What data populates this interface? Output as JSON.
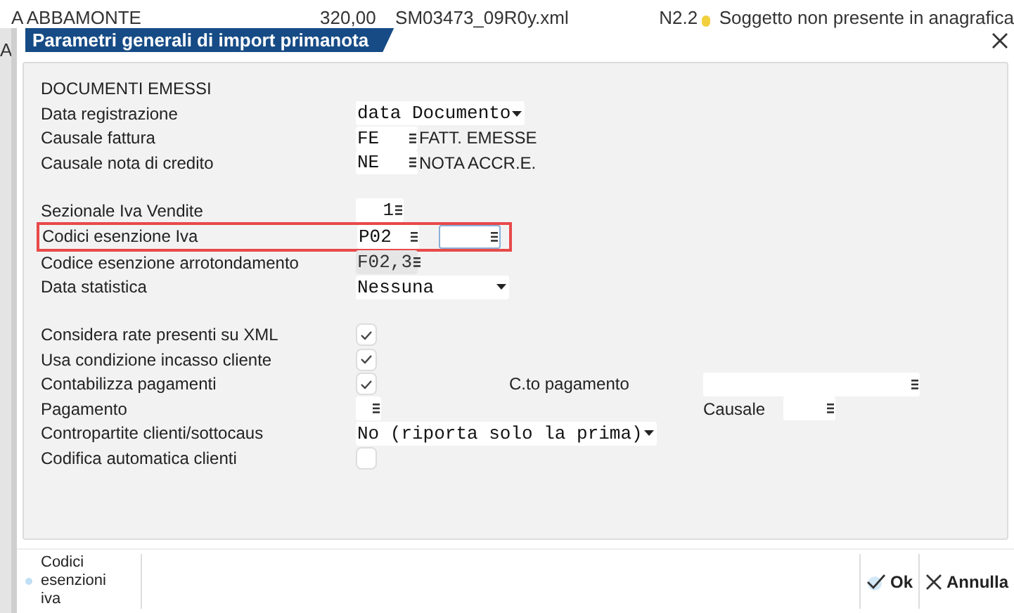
{
  "background_rows": [
    {
      "cells": [
        "A ABBAMONTE",
        "320,00",
        "SM03473_09R0y.xml",
        "N2.2",
        "Soggetto non presente in anagrafica"
      ],
      "color": "#f2cf3c"
    },
    {
      "cells": [
        "A"
      ]
    }
  ],
  "dialog": {
    "title": "Parametri generali di import primanota",
    "sections": [
      {
        "title": "DOCUMENTI EMESSI",
        "rows": [
          {
            "label": "Data registrazione",
            "fields": [
              {
                "kind": "select",
                "value": "data Documento"
              }
            ]
          },
          {
            "label": "Causale fattura",
            "fields": [
              {
                "kind": "lookup",
                "value": "FE",
                "description": "FATT. EMESSE"
              }
            ]
          },
          {
            "label": "Causale nota di credito",
            "fields": [
              {
                "kind": "lookup",
                "value": "NE",
                "description": "NOTA ACCR.E."
              }
            ]
          }
        ]
      },
      {
        "rows": [
          {
            "label": "Sezionale Iva Vendite",
            "fields": [
              {
                "kind": "number",
                "value": "1"
              }
            ]
          },
          {
            "label": "Codici esenzione Iva",
            "highlighted": true,
            "fields": [
              {
                "kind": "lookup",
                "value": "P02"
              },
              {
                "kind": "lookup",
                "focused": true
              }
            ]
          },
          {
            "label": "Codice esenzione arrotondamento",
            "fields": [
              {
                "kind": "lookup",
                "value": "F02,3",
                "disabled": true
              }
            ]
          },
          {
            "label": "Data statistica",
            "fields": [
              {
                "kind": "select",
                "value": "Nessuna"
              }
            ]
          }
        ]
      },
      {
        "rows": [
          {
            "label": "Considera rate presenti su XML",
            "fields": [
              {
                "kind": "check",
                "checked": true
              }
            ]
          },
          {
            "label": "Usa condizione incasso cliente",
            "fields": [
              {
                "kind": "check",
                "checked": true
              }
            ]
          },
          {
            "label": "Contabilizza pagamenti",
            "fields": [
              {
                "kind": "check",
                "checked": true
              }
            ],
            "extra": {
              "label": "C.to pagamento",
              "fields": [
                {
                  "kind": "lookup"
                }
              ]
            }
          },
          {
            "label": "Pagamento",
            "fields": [
              {
                "kind": "lookup"
              }
            ],
            "extra": {
              "label": "Causale",
              "fields": [
                {
                  "kind": "lookup"
                }
              ]
            }
          },
          {
            "label": "Contropartite clienti/sottocaus",
            "fields": [
              {
                "kind": "select",
                "value": "No (riporta solo la prima)"
              }
            ]
          },
          {
            "label": "Codifica automatica clienti",
            "fields": [
              {
                "kind": "check",
                "checked": false
              }
            ]
          }
        ]
      }
    ],
    "footer": {
      "side_button": "Codici esenzioni iva",
      "buttons": [
        {
          "kind": "ok",
          "label": "Ok"
        },
        {
          "kind": "cancel",
          "label": "Annulla"
        }
      ]
    }
  }
}
